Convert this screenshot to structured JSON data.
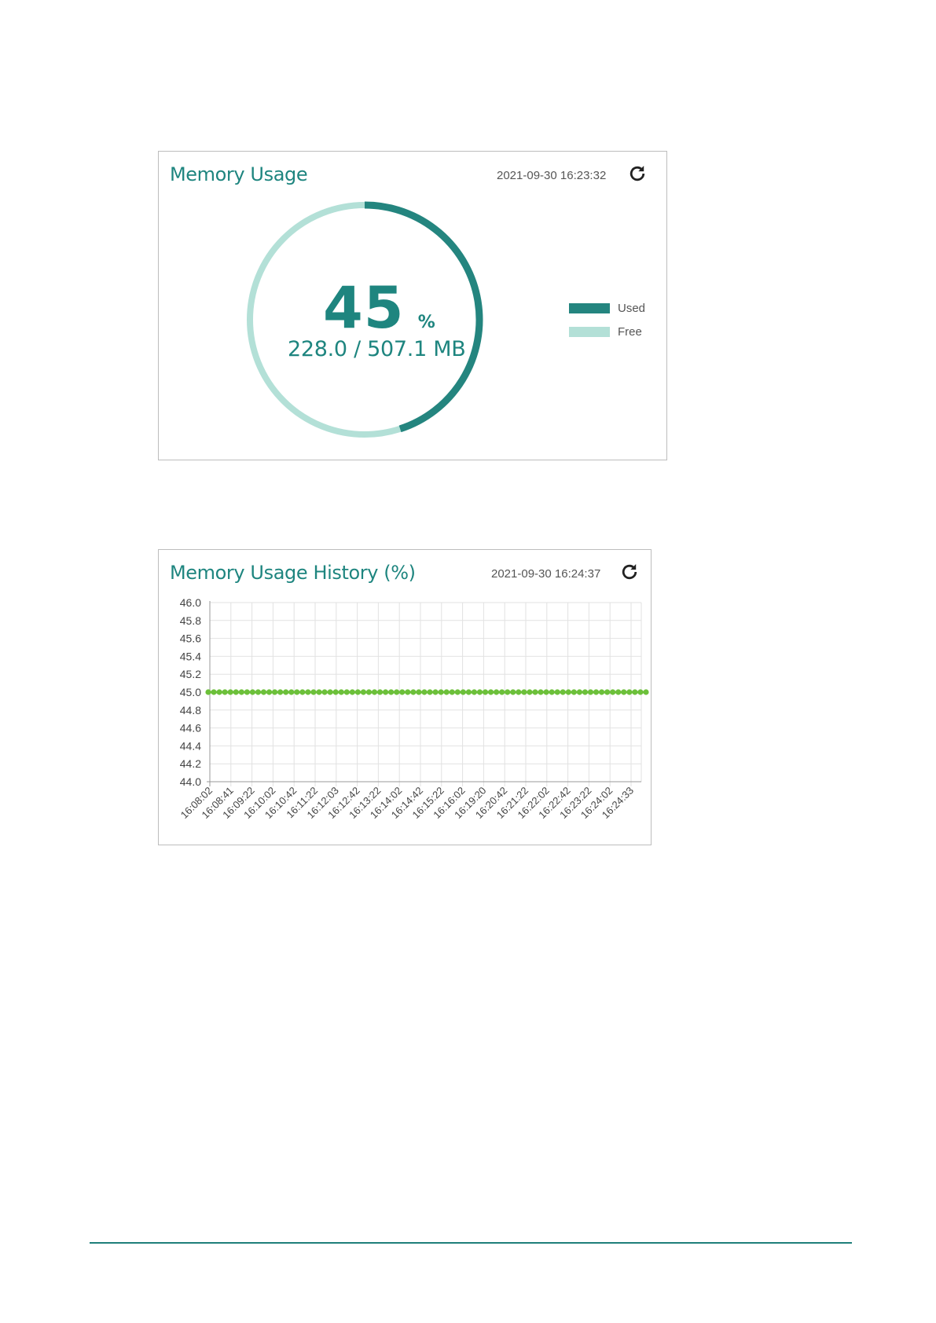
{
  "memory_usage": {
    "title": "Memory Usage",
    "timestamp": "2021-09-30 16:23:32",
    "refresh_icon": "refresh-icon",
    "percent_value": "45",
    "percent_unit": "%",
    "used_fraction": 0.45,
    "detail": "228.0 / 507.1 MB",
    "legend": [
      {
        "label": "Used",
        "color": "#24857f"
      },
      {
        "label": "Free",
        "color": "#b3e0d7"
      }
    ]
  },
  "memory_history": {
    "title": "Memory Usage History (%)",
    "timestamp": "2021-09-30 16:24:37",
    "refresh_icon": "refresh-icon"
  },
  "chart_data": {
    "type": "line",
    "ylim": [
      44.0,
      46.0
    ],
    "yticks": [
      "46.0",
      "45.8",
      "45.6",
      "45.4",
      "45.2",
      "45.0",
      "44.8",
      "44.6",
      "44.4",
      "44.2",
      "44.0"
    ],
    "xticks": [
      "16:08:02",
      "16:08:41",
      "16:09:22",
      "16:10:02",
      "16:10:42",
      "16:11:22",
      "16:12:03",
      "16:12:42",
      "16:13:22",
      "16:14:02",
      "16:14:42",
      "16:15:22",
      "16:16:02",
      "16:19:20",
      "16:20:42",
      "16:21:22",
      "16:22:02",
      "16:22:42",
      "16:23:22",
      "16:24:02",
      "16:24:33"
    ],
    "series": [
      {
        "color": "#6cc03a",
        "values": [
          45,
          45,
          45,
          45,
          45,
          45,
          45,
          45,
          45,
          45,
          45,
          45,
          45,
          45,
          45,
          45,
          45,
          45,
          45,
          45,
          45,
          45,
          45,
          45,
          45,
          45,
          45,
          45,
          45,
          45,
          45,
          45,
          45,
          45,
          45,
          45,
          45,
          45,
          45,
          45,
          45,
          45,
          45,
          45,
          45,
          45,
          45,
          45,
          45,
          45,
          45,
          45,
          45,
          45,
          45,
          45,
          45,
          45,
          45,
          45,
          45,
          45,
          45,
          45,
          45,
          45,
          45,
          45,
          45,
          45,
          45,
          45,
          45,
          45,
          45,
          45,
          45,
          45,
          45,
          45
        ]
      }
    ],
    "grid": true
  },
  "footer": {
    "rule_color": "#1e7f7a"
  }
}
